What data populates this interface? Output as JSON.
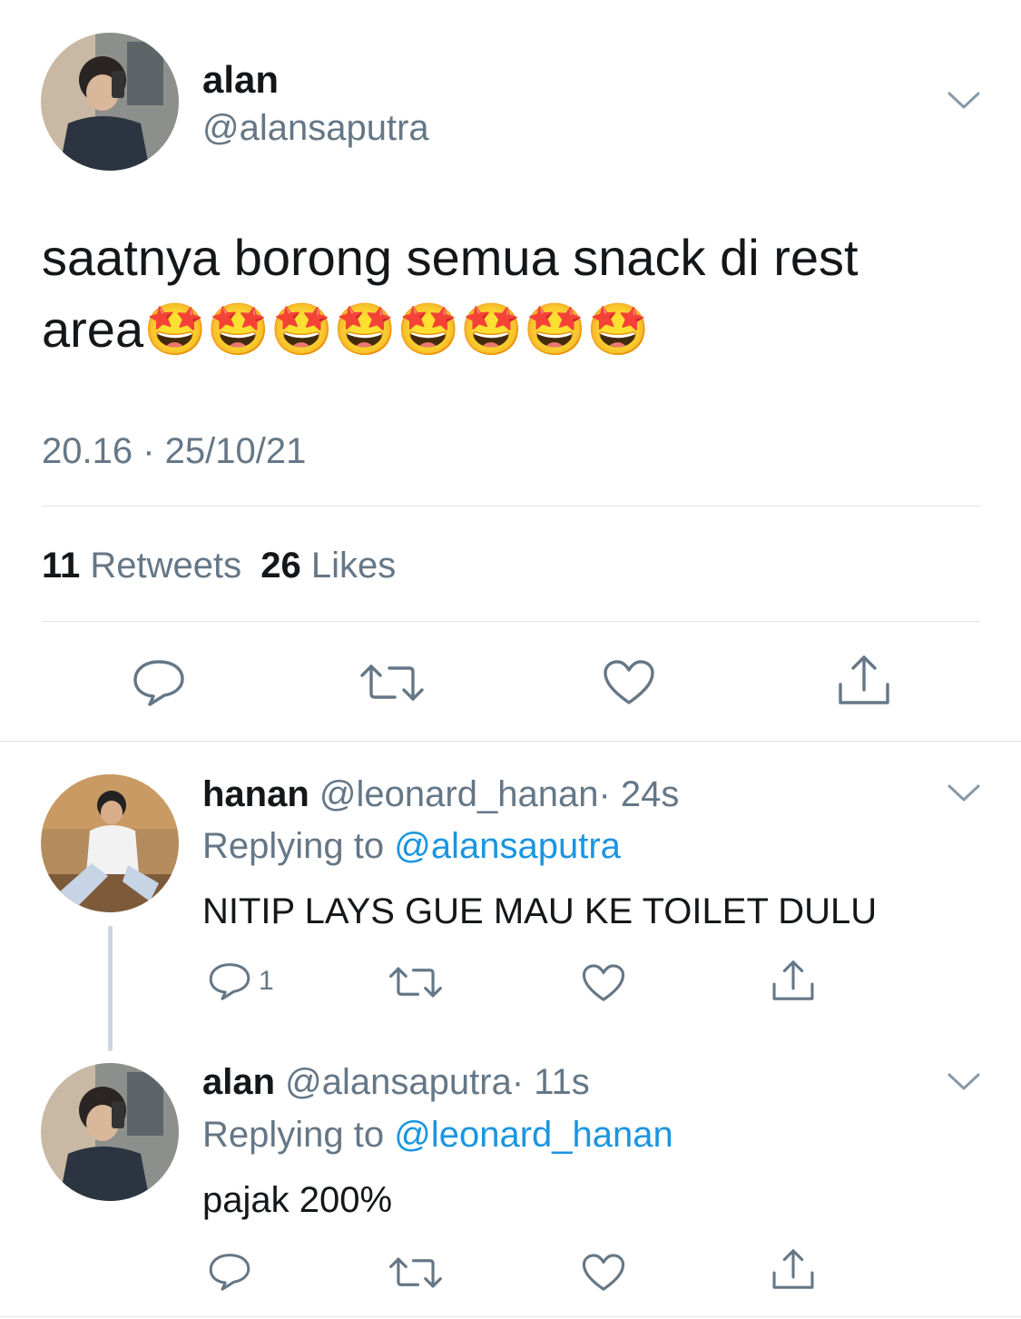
{
  "main_tweet": {
    "display_name": "alan",
    "handle": "@alansaputra",
    "text": "saatnya borong semua snack di rest area🤩🤩🤩🤩🤩🤩🤩🤩",
    "time": "20.16 · 25/10/21",
    "retweet_count": "11",
    "retweet_label": "Retweets",
    "like_count": "26",
    "like_label": "Likes"
  },
  "replies": [
    {
      "display_name": "hanan",
      "handle": "@leonard_hanan",
      "age": "· 24s",
      "replying_prefix": "Replying to",
      "replying_to": "@alansaputra",
      "text": "NITIP LAYS GUE MAU KE TOILET DULU",
      "reply_count": "1"
    },
    {
      "display_name": "alan",
      "handle": "@alansaputra",
      "age": "· 11s",
      "replying_prefix": "Replying to",
      "replying_to": "@leonard_hanan",
      "text": "pajak 200%",
      "reply_count": ""
    }
  ],
  "icons": {
    "reply": "reply-icon",
    "retweet": "retweet-icon",
    "like": "heart-icon",
    "share": "share-icon",
    "more": "chevron-down-icon"
  },
  "colors": {
    "text": "#14171a",
    "muted": "#657786",
    "link": "#1b95e0",
    "divider": "#dfe3e6",
    "thread_line": "#ccd6dd"
  }
}
